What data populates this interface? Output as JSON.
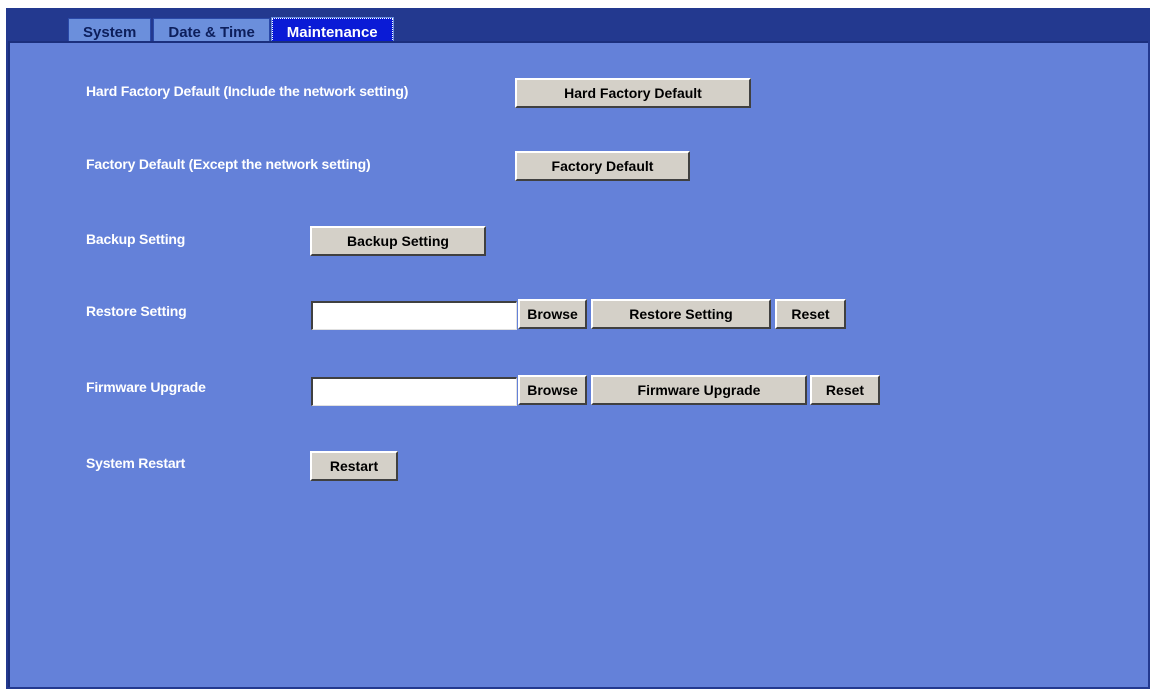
{
  "tabs": [
    {
      "label": "System"
    },
    {
      "label": "Date & Time"
    },
    {
      "label": "Maintenance"
    }
  ],
  "rows": {
    "hard_factory_default": {
      "label": "Hard Factory Default (Include the network setting)",
      "button": "Hard Factory Default"
    },
    "factory_default": {
      "label": "Factory Default (Except the network setting)",
      "button": "Factory Default"
    },
    "backup_setting": {
      "label": "Backup Setting",
      "button": "Backup Setting"
    },
    "restore_setting": {
      "label": "Restore Setting",
      "file_value": "",
      "browse": "Browse",
      "button": "Restore Setting",
      "reset": "Reset"
    },
    "firmware_upgrade": {
      "label": "Firmware Upgrade",
      "file_value": "",
      "browse": "Browse",
      "button": "Firmware Upgrade",
      "reset": "Reset"
    },
    "system_restart": {
      "label": "System Restart",
      "button": "Restart"
    }
  },
  "colors": {
    "frame": "#23398f",
    "panel": "#6481d9",
    "tab": "#6b8fdc",
    "active_tab": "#0a1bd6",
    "button": "#d4d0c8"
  }
}
